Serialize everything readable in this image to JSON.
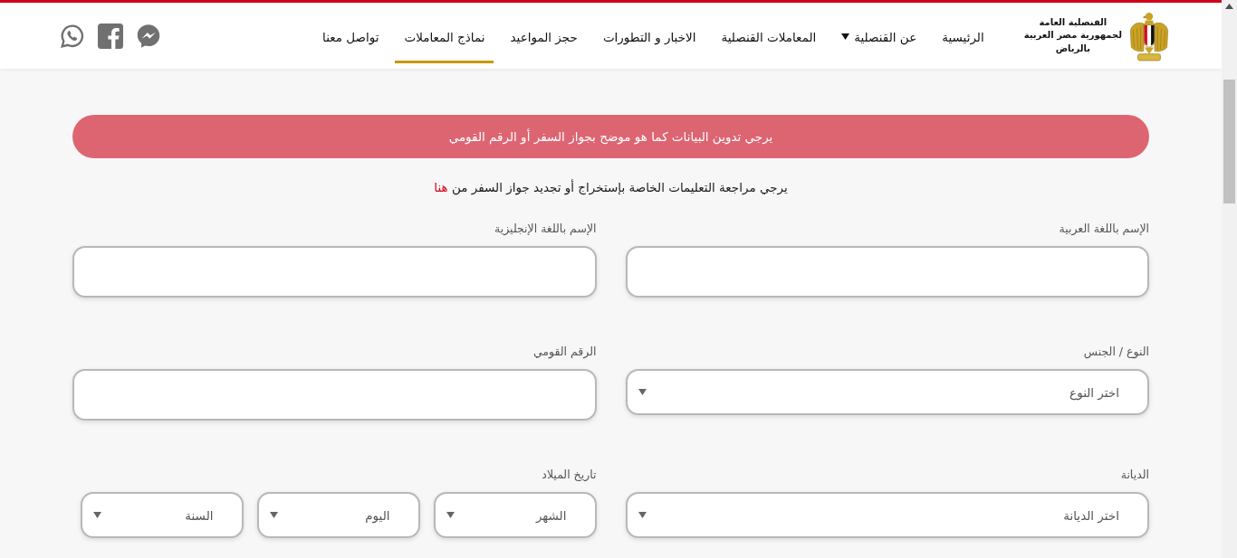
{
  "header": {
    "brand_lines": [
      "القنصلية العامة",
      "لجمهورية مصر العربية",
      "بالرياض"
    ],
    "nav": [
      {
        "label": "الرئيسية",
        "selected": false,
        "dropdown": false
      },
      {
        "label": "عن القنصلية",
        "selected": false,
        "dropdown": true
      },
      {
        "label": "المعاملات القنصلية",
        "selected": false,
        "dropdown": false
      },
      {
        "label": "الاخبار و التطورات",
        "selected": false,
        "dropdown": false
      },
      {
        "label": "حجز المواعيد",
        "selected": false,
        "dropdown": false
      },
      {
        "label": "نماذج المعاملات",
        "selected": true,
        "dropdown": false
      },
      {
        "label": "تواصل معنا",
        "selected": false,
        "dropdown": false
      }
    ]
  },
  "notice": {
    "text": "يرجي تدوين البيانات كما هو موضح بجواز السفر أو الرقم القومي"
  },
  "instructions": {
    "text": "يرجي مراجعة التعليمات الخاصة بإستخراج أو تجديد جواز السفر من",
    "link": "هنا"
  },
  "form": {
    "rows": [
      [
        {
          "label": "الإسم باللغة العربية",
          "kind": "text"
        },
        {
          "label": "الإسم باللغة الإنجليزية",
          "kind": "text"
        }
      ],
      [
        {
          "label": "النوع / الجنس",
          "kind": "select",
          "value": "اختر النوع"
        },
        {
          "label": "الرقم القومي",
          "kind": "text"
        }
      ],
      [
        {
          "label": "الديانة",
          "kind": "select",
          "value": "اختر الديانة"
        },
        {
          "label": "تاريخ الميلاد",
          "kind": "date",
          "selects": [
            {
              "value": "الشهر"
            },
            {
              "value": "اليوم"
            },
            {
              "value": "السنة"
            }
          ]
        }
      ]
    ]
  }
}
